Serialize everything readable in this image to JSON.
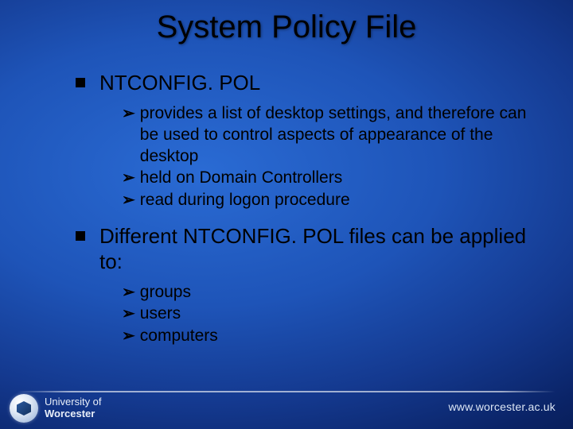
{
  "title": "System Policy File",
  "bullets": [
    {
      "text": "NTCONFIG. POL",
      "subs": [
        "provides a list of desktop settings, and therefore can be used to control aspects of appearance of the desktop",
        "held on Domain Controllers",
        "read during logon procedure"
      ]
    },
    {
      "text": "Different NTCONFIG. POL files can be applied to:",
      "subs": [
        "groups",
        "users",
        "computers"
      ]
    }
  ],
  "footer": {
    "org_line1": "University of",
    "org_line2": "Worcester",
    "url": "www.worcester.ac.uk"
  }
}
